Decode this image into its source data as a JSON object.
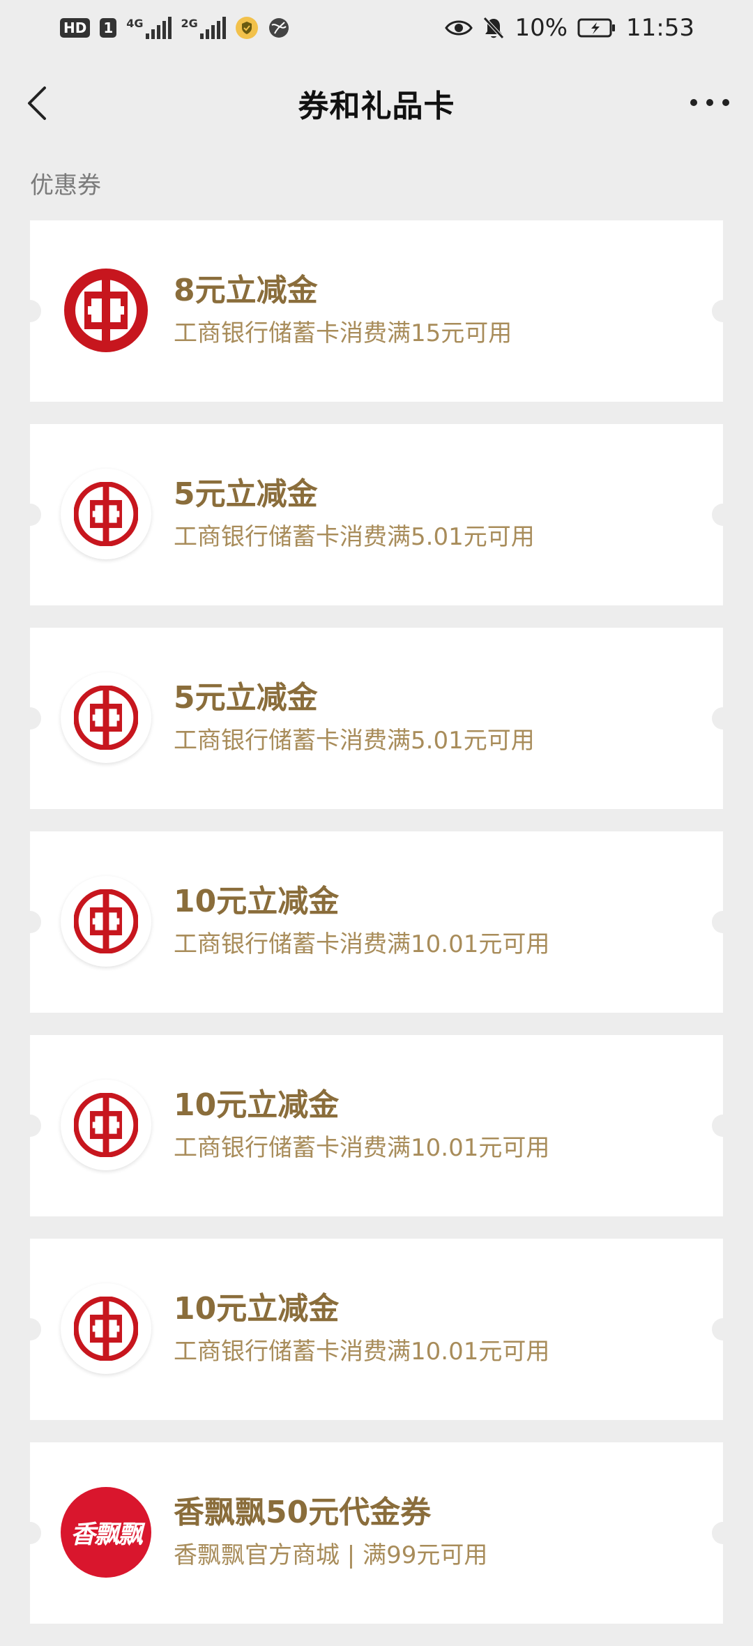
{
  "status_bar": {
    "hd": "HD",
    "sim1": "1",
    "net1": "4G",
    "net2": "2G",
    "battery": "10%",
    "time": "11:53"
  },
  "nav": {
    "title": "券和礼品卡"
  },
  "section": {
    "label": "优惠券"
  },
  "coupons": [
    {
      "title": "8元立减金",
      "desc": "工商银行储蓄卡消费满15元可用",
      "logo": "icbc-logo"
    },
    {
      "title": "5元立减金",
      "desc": "工商银行储蓄卡消费满5.01元可用",
      "logo": "icbc-logo"
    },
    {
      "title": "5元立减金",
      "desc": "工商银行储蓄卡消费满5.01元可用",
      "logo": "icbc-logo"
    },
    {
      "title": "10元立减金",
      "desc": "工商银行储蓄卡消费满10.01元可用",
      "logo": "icbc-logo"
    },
    {
      "title": "10元立减金",
      "desc": "工商银行储蓄卡消费满10.01元可用",
      "logo": "icbc-logo"
    },
    {
      "title": "10元立减金",
      "desc": "工商银行储蓄卡消费满10.01元可用",
      "logo": "icbc-logo"
    },
    {
      "title": "香飘飘50元代金券",
      "desc": "香飘飘官方商城 | 满99元可用",
      "logo": "xiangpiaopiao-logo",
      "logo_text": "香飘飘"
    }
  ],
  "colors": {
    "background": "#ededed",
    "card": "#ffffff",
    "title_gold": "#8a6d3b",
    "desc_gold": "#a88c5a",
    "icbc_red": "#c7161e",
    "xpp_red": "#d9162d"
  }
}
